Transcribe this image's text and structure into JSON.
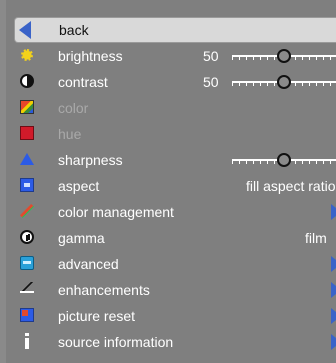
{
  "menu": {
    "back_label": "back",
    "items": [
      {
        "label": "brightness",
        "value": "50",
        "slider": 0.5,
        "icon": "sun-icon",
        "enabled": true
      },
      {
        "label": "contrast",
        "value": "50",
        "slider": 0.5,
        "icon": "contrast-icon",
        "enabled": true
      },
      {
        "label": "color",
        "icon": "color-palette-icon",
        "enabled": false
      },
      {
        "label": "hue",
        "icon": "hue-icon",
        "enabled": false
      },
      {
        "label": "sharpness",
        "slider": 0.5,
        "icon": "sharpness-triangle-icon",
        "enabled": true
      },
      {
        "label": "aspect",
        "value": "fill aspect ratio",
        "icon": "aspect-icon",
        "enabled": true
      },
      {
        "label": "color management",
        "icon": "color-management-icon",
        "has_submenu": true,
        "enabled": true
      },
      {
        "label": "gamma",
        "value": "film",
        "icon": "gamma-icon",
        "enabled": true
      },
      {
        "label": "advanced",
        "icon": "advanced-icon",
        "has_submenu": true,
        "enabled": true
      },
      {
        "label": "enhancements",
        "icon": "enhancements-icon",
        "has_submenu": true,
        "enabled": true
      },
      {
        "label": "picture reset",
        "icon": "picture-reset-icon",
        "has_submenu": true,
        "enabled": true
      },
      {
        "label": "source information",
        "icon": "info-icon",
        "has_submenu": true,
        "enabled": true
      }
    ]
  },
  "colors": {
    "panel": "#7f7f7f",
    "selected_row": "#d9d9d9",
    "accent_blue": "#3a63c8",
    "disabled_text": "#a9a9a9"
  }
}
